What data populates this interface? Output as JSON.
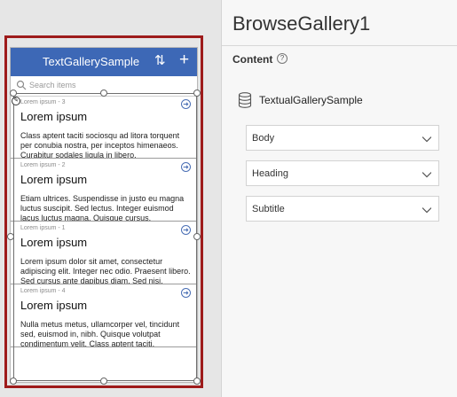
{
  "gallery_app": {
    "title": "TextGallerySample",
    "search_placeholder": "Search items",
    "items": [
      {
        "subtitle": "Lorem ipsum - 3",
        "heading": "Lorem ipsum",
        "body": "Class aptent taciti sociosqu ad litora torquent per conubia nostra, per inceptos himenaeos. Curabitur sodales ligula in libero."
      },
      {
        "subtitle": "Lorem ipsum - 2",
        "heading": "Lorem ipsum",
        "body": "Etiam ultrices. Suspendisse in justo eu magna luctus suscipit. Sed lectus. Integer euismod lacus luctus magna. Quisque cursus."
      },
      {
        "subtitle": "Lorem ipsum - 1",
        "heading": "Lorem ipsum",
        "body": "Lorem ipsum dolor sit amet, consectetur adipiscing elit. Integer nec odio. Praesent libero. Sed cursus ante dapibus diam. Sed nisi."
      },
      {
        "subtitle": "Lorem ipsum - 4",
        "heading": "Lorem ipsum",
        "body": "Nulla metus metus, ullamcorper vel, tincidunt sed, euismod in, nibh. Quisque volutpat condimentum velit. Class aptent taciti."
      }
    ]
  },
  "panel": {
    "control_name": "BrowseGallery1",
    "content_label": "Content",
    "data_source": "TextualGallerySample",
    "dropdowns": [
      "Body",
      "Heading",
      "Subtitle"
    ]
  },
  "colors": {
    "header": "#3d68b6",
    "selection": "#9e1b1b"
  },
  "icons": [
    "sort-icon",
    "add-icon",
    "search-icon",
    "next-arrow-icon",
    "edit-icon",
    "help-icon",
    "database-icon",
    "chevron-down-icon"
  ]
}
